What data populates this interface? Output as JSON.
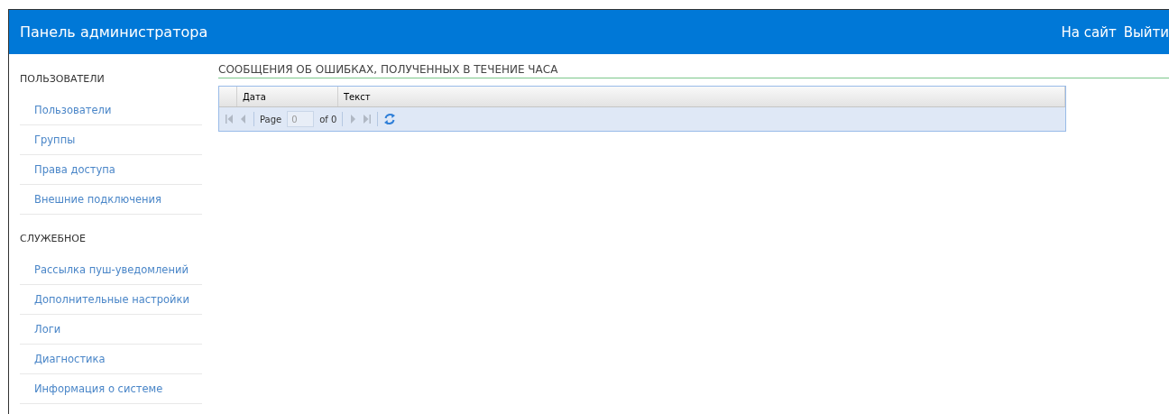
{
  "header": {
    "title": "Панель администратора",
    "links": [
      "На сайт",
      "Выйти"
    ]
  },
  "sidebar": {
    "sections": [
      {
        "title": "ПОЛЬЗОВАТЕЛИ",
        "items": [
          "Пользователи",
          "Группы",
          "Права доступа",
          "Внешние подключения"
        ]
      },
      {
        "title": "СЛУЖЕБНОЕ",
        "items": [
          "Рассылка пуш-уведомлений",
          "Дополнительные настройки",
          "Логи",
          "Диагностика",
          "Информация о системе"
        ]
      }
    ]
  },
  "content": {
    "title": "СООБЩЕНИЯ ОБ ОШИБКАХ, ПОЛУЧЕННЫХ В ТЕЧЕНИЕ ЧАСА",
    "table": {
      "columns": [
        "Дата",
        "Текст"
      ]
    },
    "pager": {
      "page_label": "Page",
      "page_value": "0",
      "of_label": "of 0"
    }
  }
}
